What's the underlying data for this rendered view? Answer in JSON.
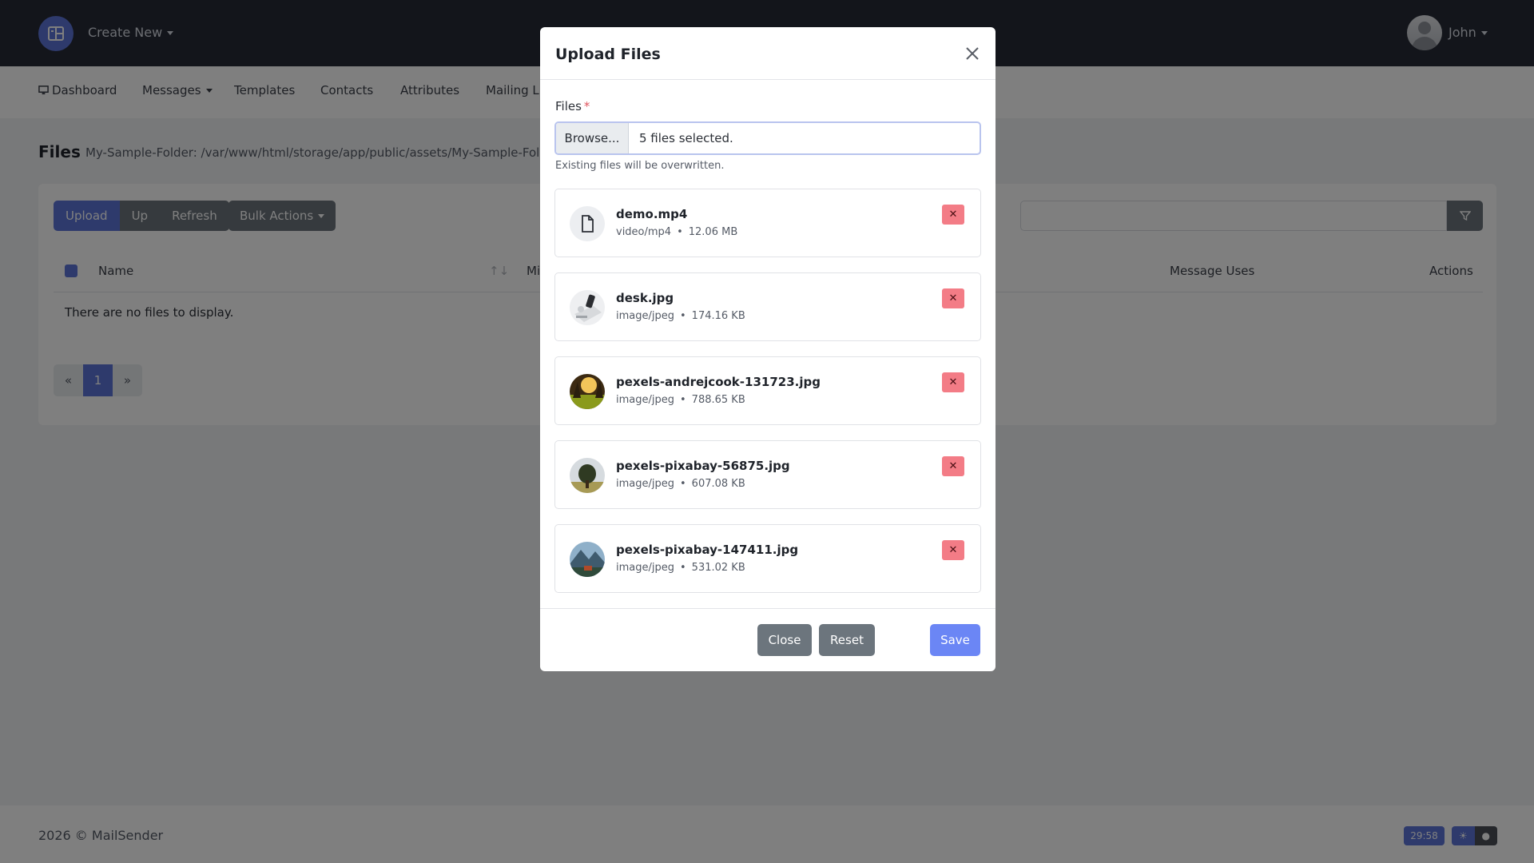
{
  "topbar": {
    "create_new_label": "Create New",
    "user_name": "John"
  },
  "subnav": {
    "items": [
      {
        "label": "Dashboard"
      },
      {
        "label": "Messages"
      },
      {
        "label": "Templates"
      },
      {
        "label": "Contacts"
      },
      {
        "label": "Attributes"
      },
      {
        "label": "Mailing Lis"
      }
    ]
  },
  "page": {
    "title": "Files",
    "path": "My-Sample-Folder: /var/www/html/storage/app/public/assets/My-Sample-Folder"
  },
  "toolbar": {
    "upload_label": "Upload",
    "up_label": "Up",
    "refresh_label": "Refresh",
    "bulk_actions_label": "Bulk Actions"
  },
  "table": {
    "headers": {
      "name": "Name",
      "mime": "Mi",
      "message_uses": "Message Uses",
      "actions": "Actions"
    },
    "empty_message": "There are no files to display."
  },
  "pagination": {
    "prev": "«",
    "current": "1",
    "next": "»"
  },
  "footer": {
    "text": "2026 © MailSender",
    "timer": "29:58"
  },
  "modal": {
    "title": "Upload Files",
    "field_label": "Files",
    "required_mark": "*",
    "browse_label": "Browse...",
    "selected_text": "5 files selected.",
    "help_text": "Existing files will be overwritten.",
    "files": [
      {
        "name": "demo.mp4",
        "type": "video/mp4",
        "size": "12.06 MB",
        "icon": "document-icon"
      },
      {
        "name": "desk.jpg",
        "type": "image/jpeg",
        "size": "174.16 KB",
        "icon": "image-thumbnail"
      },
      {
        "name": "pexels-andrejcook-131723.jpg",
        "type": "image/jpeg",
        "size": "788.65 KB",
        "icon": "image-thumbnail"
      },
      {
        "name": "pexels-pixabay-56875.jpg",
        "type": "image/jpeg",
        "size": "607.08 KB",
        "icon": "image-thumbnail"
      },
      {
        "name": "pexels-pixabay-147411.jpg",
        "type": "image/jpeg",
        "size": "531.02 KB",
        "icon": "image-thumbnail"
      }
    ],
    "close_label": "Close",
    "reset_label": "Reset",
    "save_label": "Save"
  },
  "colors": {
    "primary": "#5c74d8",
    "danger_light": "#f37c86",
    "secondary": "#6c757d",
    "navbar": "#262b36"
  }
}
